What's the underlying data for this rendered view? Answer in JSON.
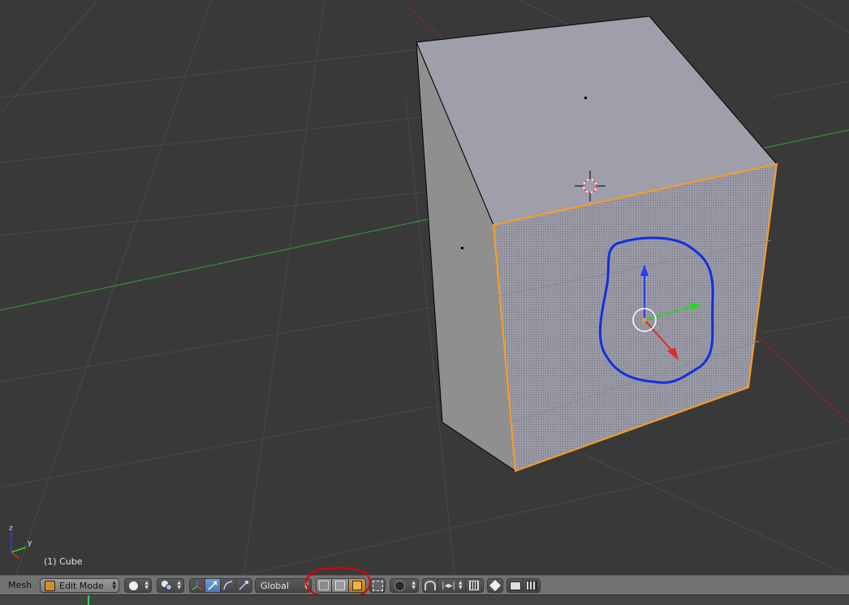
{
  "viewport": {
    "object_info": "(1) Cube",
    "axis_labels": {
      "z": "z",
      "y": "y"
    }
  },
  "header": {
    "editor_menu": "Mesh",
    "mode_selector": {
      "label": "Edit Mode"
    },
    "orientation": {
      "label": "Global"
    }
  },
  "icons": [
    "mode-cube-icon",
    "viewport-shading-solid-icon",
    "pivot-point-icon",
    "manipulator-toggle-icon",
    "translate-manipulator-icon",
    "rotate-manipulator-icon",
    "scale-manipulator-icon",
    "vertex-select-icon",
    "edge-select-icon",
    "face-select-icon",
    "limit-selection-to-visible-icon",
    "proportional-editing-icon",
    "snap-toggle-icon",
    "snap-element-icon",
    "snap-target-icon",
    "overlay-toggle-icon",
    "render-still-icon",
    "render-animation-icon"
  ],
  "colors": {
    "viewport_bg": "#393939",
    "grid": "#4a4a4a",
    "x_axis": "#8c2b2b",
    "y_axis": "#3e9c3e",
    "selection_edge": "#ff9d1f",
    "annotation_circle_red": "#e00000",
    "annotation_circle_blue": "#1030e0",
    "header_bg": "#727272"
  }
}
